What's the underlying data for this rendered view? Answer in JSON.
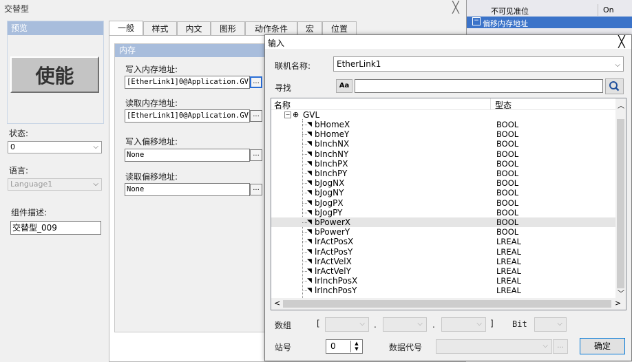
{
  "main_window": {
    "title": "交替型",
    "close_glyph": "╳",
    "preview": {
      "header": "预览",
      "button_label": "使能"
    },
    "state": {
      "label": "状态:",
      "value": "0"
    },
    "language": {
      "label": "语言:",
      "value": "Language1"
    },
    "description": {
      "label": "组件描述:",
      "value": "交替型_009"
    },
    "tabs": [
      "一般",
      "样式",
      "内文",
      "图形",
      "动作条件",
      "宏",
      "位置"
    ],
    "memory": {
      "header": "内存",
      "write_label": "写入内存地址:",
      "write_value": "[EtherLink1]0@Application.GV",
      "read_label": "读取内存地址:",
      "read_value": "[EtherLink1]0@Application.GV",
      "write_offset_label": "写入偏移地址:",
      "write_offset_value": "None",
      "read_offset_label": "读取偏移地址:",
      "read_offset_value": "None",
      "dots": "..."
    }
  },
  "property_panel": {
    "rows": [
      {
        "name": "不可见准位",
        "value": "On"
      },
      {
        "name": "偏移内存地址",
        "value": ""
      }
    ]
  },
  "dialog": {
    "title": "输入",
    "close_glyph": "╳",
    "conn_label": "联机名称:",
    "conn_value": "EtherLink1",
    "search_label": "寻找",
    "aa_label": "Aa",
    "col_name": "名称",
    "col_type": "型态",
    "group": "GVL",
    "variables": [
      {
        "name": "bHomeX",
        "type": "BOOL"
      },
      {
        "name": "bHomeY",
        "type": "BOOL"
      },
      {
        "name": "bInchNX",
        "type": "BOOL"
      },
      {
        "name": "bInchNY",
        "type": "BOOL"
      },
      {
        "name": "bInchPX",
        "type": "BOOL"
      },
      {
        "name": "bInchPY",
        "type": "BOOL"
      },
      {
        "name": "bJogNX",
        "type": "BOOL"
      },
      {
        "name": "bJogNY",
        "type": "BOOL"
      },
      {
        "name": "bJogPX",
        "type": "BOOL"
      },
      {
        "name": "bJogPY",
        "type": "BOOL"
      },
      {
        "name": "bPowerX",
        "type": "BOOL"
      },
      {
        "name": "bPowerY",
        "type": "BOOL"
      },
      {
        "name": "lrActPosX",
        "type": "LREAL"
      },
      {
        "name": "lrActPosY",
        "type": "LREAL"
      },
      {
        "name": "lrActVelX",
        "type": "LREAL"
      },
      {
        "name": "lrActVelY",
        "type": "LREAL"
      },
      {
        "name": "lrInchPosX",
        "type": "LREAL"
      },
      {
        "name": "lrInchPosY",
        "type": "LREAL"
      }
    ],
    "selected_variable": "bPowerX",
    "array_label": "数组",
    "bracket_open": "[",
    "bracket_close": "]",
    "dot": ".",
    "bit_label": "Bit",
    "station_label": "站号",
    "station_value": "0",
    "data_code_label": "数据代号",
    "dots": "...",
    "ok_label": "确定"
  }
}
